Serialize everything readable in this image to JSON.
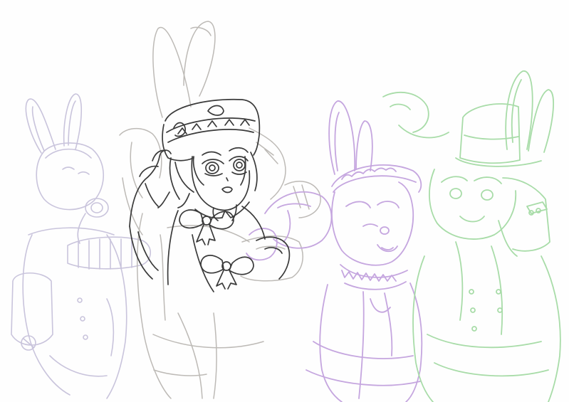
{
  "artwork": {
    "kind": "sketch",
    "background_color": "#fefefe",
    "colors": {
      "lavender_figure": "#c9c4dc",
      "gray_figure": "#bdbab6",
      "center_ink": "#3a3a3a",
      "purple_figure": "#c5a6df",
      "green_figure": "#a8dca8"
    },
    "figures": [
      {
        "name": "lavender-bunny-with-mask",
        "color_key": "lavender_figure"
      },
      {
        "name": "gray-background-figure",
        "color_key": "gray_figure"
      },
      {
        "name": "center-bunny-top-hat-inked",
        "color_key": "center_ink"
      },
      {
        "name": "purple-bunny-maid-winking",
        "color_key": "purple_figure"
      },
      {
        "name": "green-bunny-top-hat",
        "color_key": "green_figure"
      }
    ]
  }
}
